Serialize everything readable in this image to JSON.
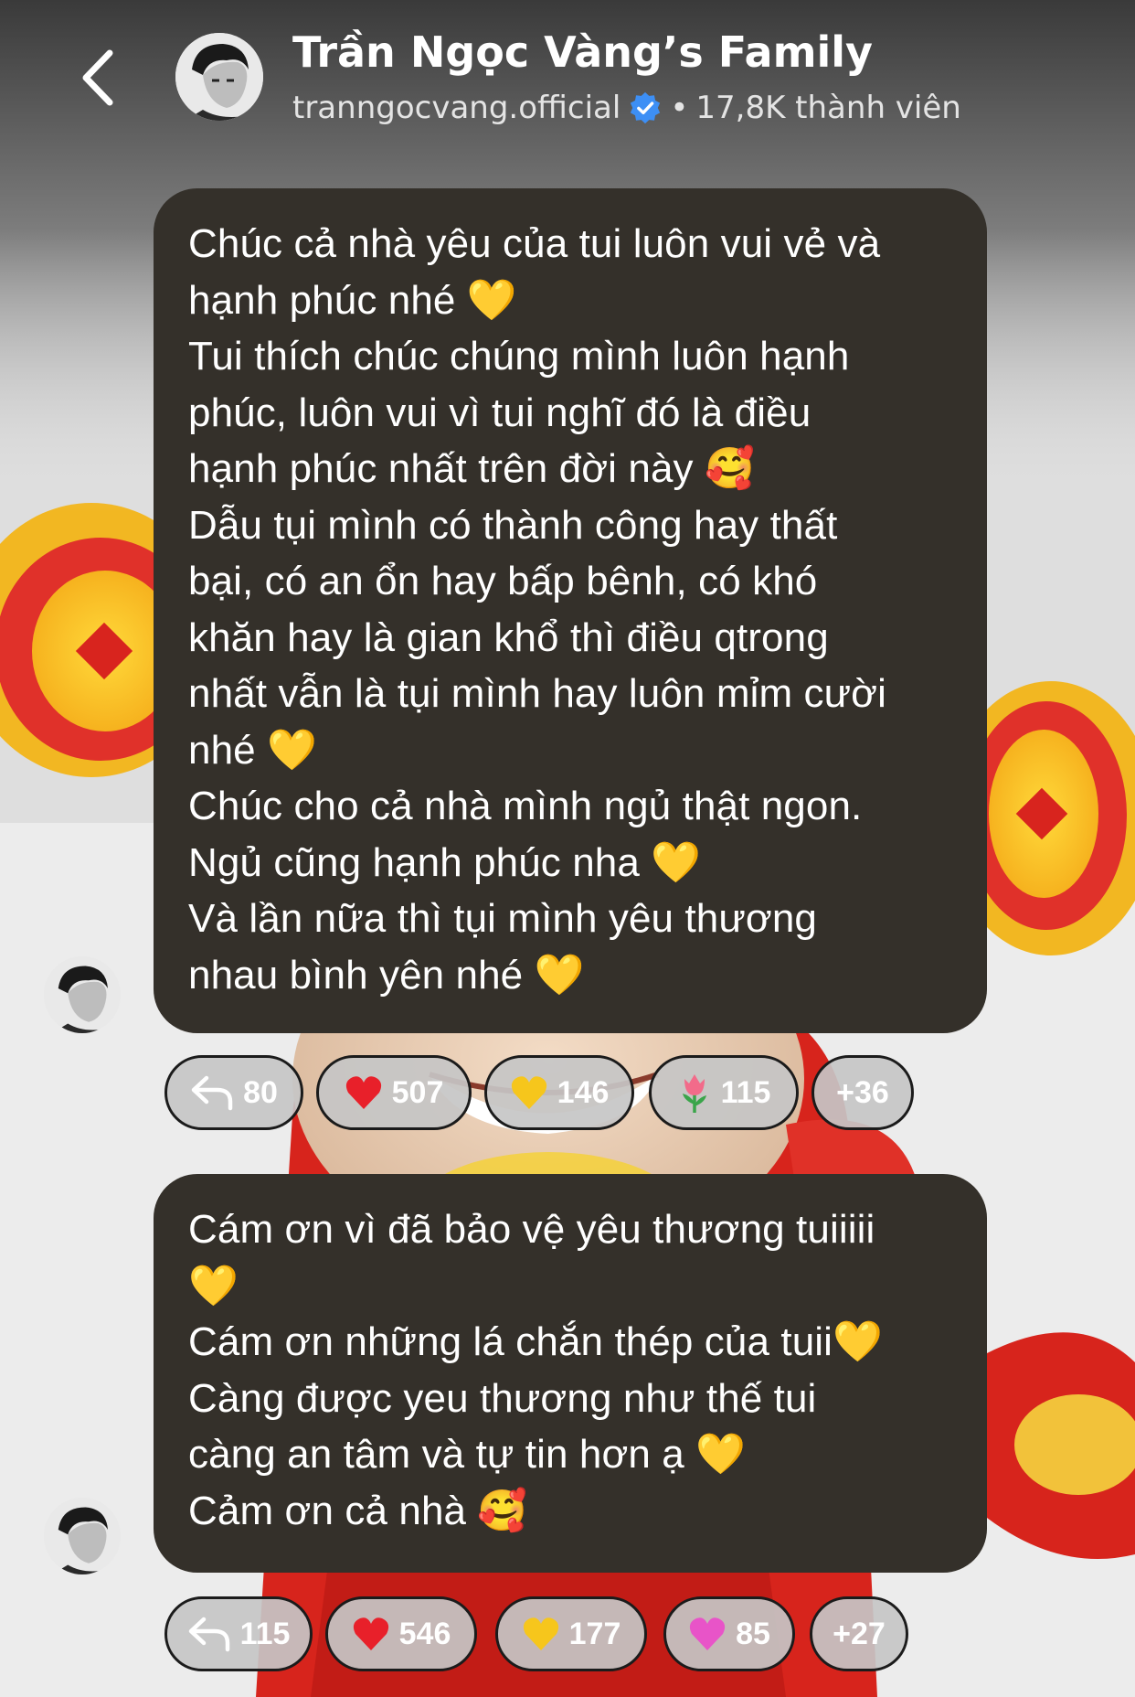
{
  "header": {
    "back_icon": "chevron-left-icon",
    "title": "Trần Ngọc Vàng’s Family",
    "handle": "tranngocvang.official",
    "verified_icon": "verified-badge-icon",
    "separator": "•",
    "members": "17,8K thành viên"
  },
  "messages": [
    {
      "lines": [
        "Chúc cả nhà yêu của tui luôn vui vẻ và",
        "hạnh phúc nhé 💛",
        "Tui thích chúc chúng mình luôn hạnh",
        "phúc, luôn vui vì tui nghĩ đó là điều",
        "hạnh phúc nhất trên đời này 🥰",
        "Dẫu tụi mình có thành công hay thất",
        "bại, có an ổn hay bấp bênh, có khó",
        "khăn hay là gian khổ thì điều qtrong",
        "nhất vẫn là tụi mình hay luôn mỉm cười",
        "nhé 💛",
        "Chúc cho cả nhà mình ngủ thật ngon.",
        "Ngủ cũng hạnh phúc nha 💛",
        "Và lần nữa thì tụi mình yêu thương",
        "nhau bình yên nhé 💛"
      ],
      "reactions": [
        {
          "icon": "reply-icon",
          "count": "80"
        },
        {
          "icon": "red-heart-icon",
          "count": "507"
        },
        {
          "icon": "yellow-heart-icon",
          "count": "146"
        },
        {
          "icon": "tulip-icon",
          "count": "115"
        },
        {
          "icon": "",
          "count": "+36"
        }
      ]
    },
    {
      "lines": [
        "Cám ơn vì đã bảo vệ yêu thương tuiiiii",
        "💛",
        "Cám ơn những lá chắn thép của tuii💛",
        "Càng được yeu thương như thế tui",
        "càng an tâm và tự tin hơn ạ 💛",
        "Cảm ơn cả nhà 🥰"
      ],
      "reactions": [
        {
          "icon": "reply-icon",
          "count": "115"
        },
        {
          "icon": "red-heart-icon",
          "count": "546"
        },
        {
          "icon": "yellow-heart-icon",
          "count": "177"
        },
        {
          "icon": "pink-heart-icon",
          "count": "85"
        },
        {
          "icon": "",
          "count": "+27"
        }
      ]
    }
  ],
  "colors": {
    "bubble": "#34302a",
    "chip": "#c6c6c6",
    "verified": "#3d8ff5"
  }
}
